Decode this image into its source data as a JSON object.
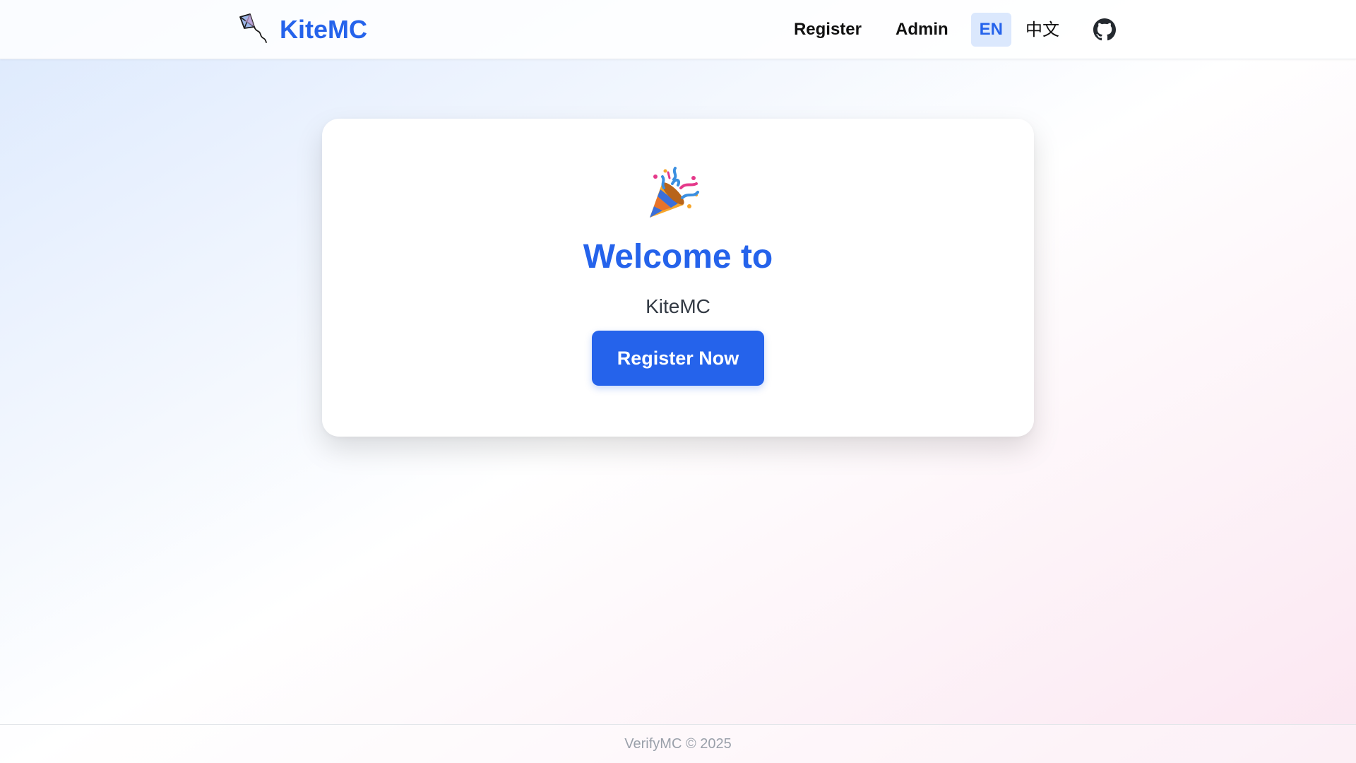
{
  "brand": {
    "name": "KiteMC",
    "icon": "kite-icon",
    "color": "#2563eb"
  },
  "nav": {
    "register_label": "Register",
    "admin_label": "Admin",
    "languages": [
      {
        "label": "EN",
        "active": true
      },
      {
        "label": "中文",
        "active": false
      }
    ],
    "github_icon": "github-icon"
  },
  "hero": {
    "icon": "party-popper-icon",
    "welcome_text": "Welcome to",
    "server_name": "KiteMC",
    "cta_label": "Register Now"
  },
  "footer": {
    "text": "VerifyMC © 2025"
  },
  "colors": {
    "primary": "#2563eb",
    "active_lang_bg": "#dbe8fd"
  }
}
